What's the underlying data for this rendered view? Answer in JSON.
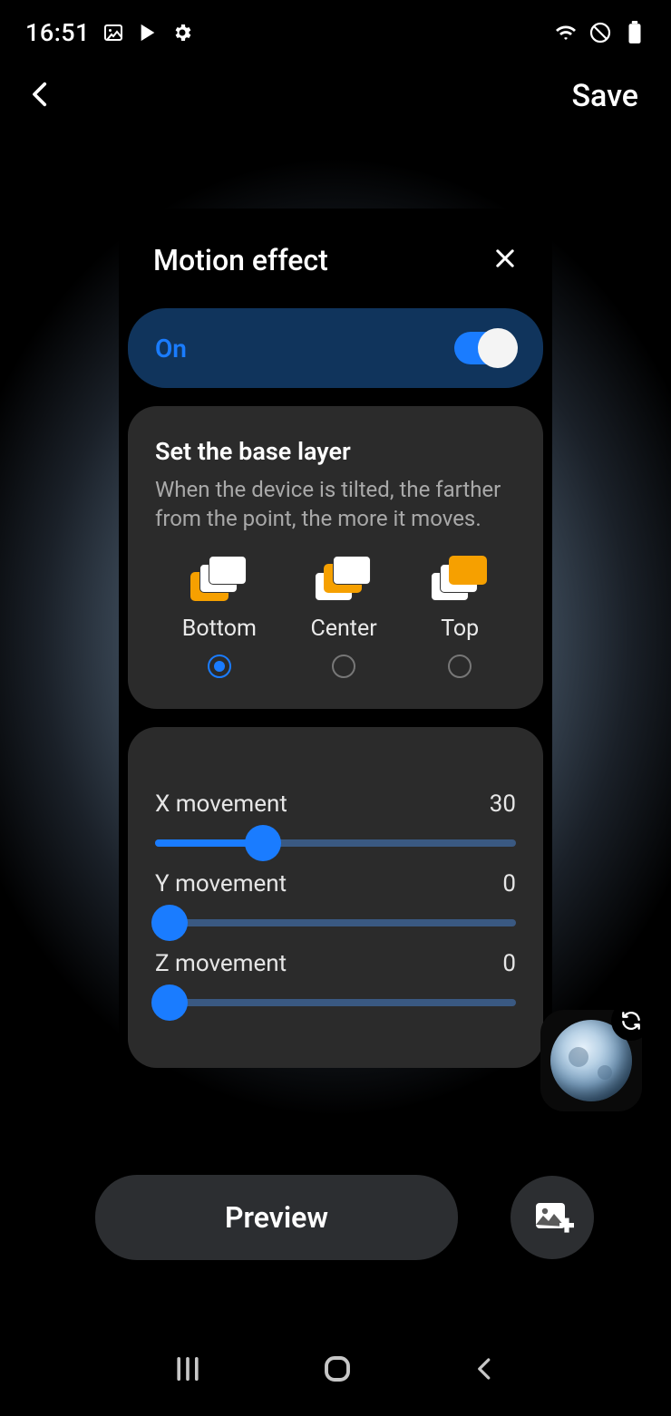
{
  "status": {
    "time": "16:51"
  },
  "topbar": {
    "save_label": "Save"
  },
  "panel": {
    "title": "Motion effect",
    "toggle_label": "On",
    "base": {
      "title": "Set the base layer",
      "desc": "When the device is tilted, the farther from the point, the more it moves.",
      "options": [
        {
          "label": "Bottom",
          "selected": true
        },
        {
          "label": "Center",
          "selected": false
        },
        {
          "label": "Top",
          "selected": false
        }
      ]
    },
    "sliders": {
      "x": {
        "label": "X movement",
        "value": 30,
        "max": 100
      },
      "y": {
        "label": "Y movement",
        "value": 0,
        "max": 100
      },
      "z": {
        "label": "Z movement",
        "value": 0,
        "max": 100
      }
    }
  },
  "bottom": {
    "preview_label": "Preview"
  }
}
